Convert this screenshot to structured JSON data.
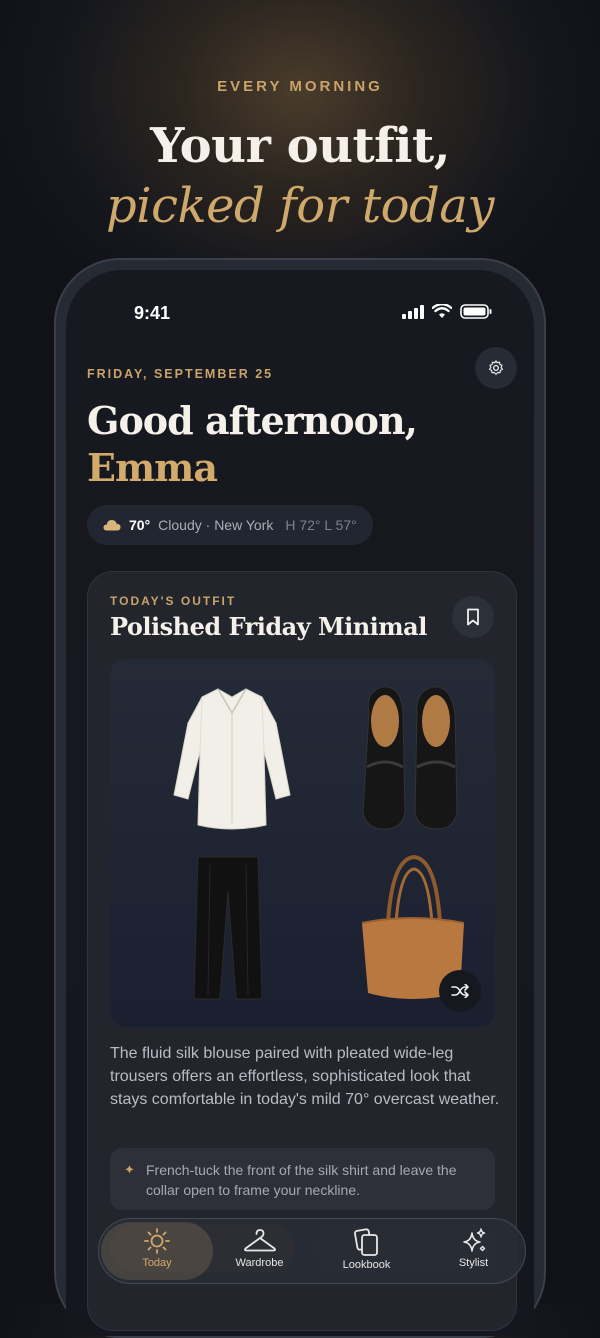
{
  "promo": {
    "eyebrow": "EVERY MORNING",
    "title": "Your outfit,",
    "subtitle": "picked for today"
  },
  "status_bar": {
    "time": "9:41"
  },
  "header": {
    "date": "FRIDAY, SEPTEMBER 25",
    "greeting": "Good afternoon,",
    "name": "Emma"
  },
  "weather": {
    "icon": "cloud-icon",
    "temp": "70°",
    "condition": "Cloudy · New York",
    "hilo": "H 72° L 57°"
  },
  "outfit": {
    "eyebrow": "TODAY'S OUTFIT",
    "title": "Polished Friday Minimal",
    "items": [
      "silk-blouse",
      "black-loafers",
      "wide-leg-trousers",
      "tan-tote-bag"
    ],
    "description": "The fluid silk blouse paired with pleated wide-leg trousers offers an effortless, sophisticated look that stays comfortable in today's mild 70° overcast weather.",
    "tip": "French-tuck the front of the silk shirt and leave the collar open to frame your neckline."
  },
  "tabs": [
    {
      "label": "Today",
      "icon": "sun-icon",
      "active": true
    },
    {
      "label": "Wardrobe",
      "icon": "hanger-icon",
      "active": false
    },
    {
      "label": "Lookbook",
      "icon": "cards-icon",
      "active": false
    },
    {
      "label": "Stylist",
      "icon": "sparkle-icon",
      "active": false
    }
  ],
  "colors": {
    "accent": "#c9a36a",
    "background": "#14171d",
    "card": "#22252c"
  }
}
